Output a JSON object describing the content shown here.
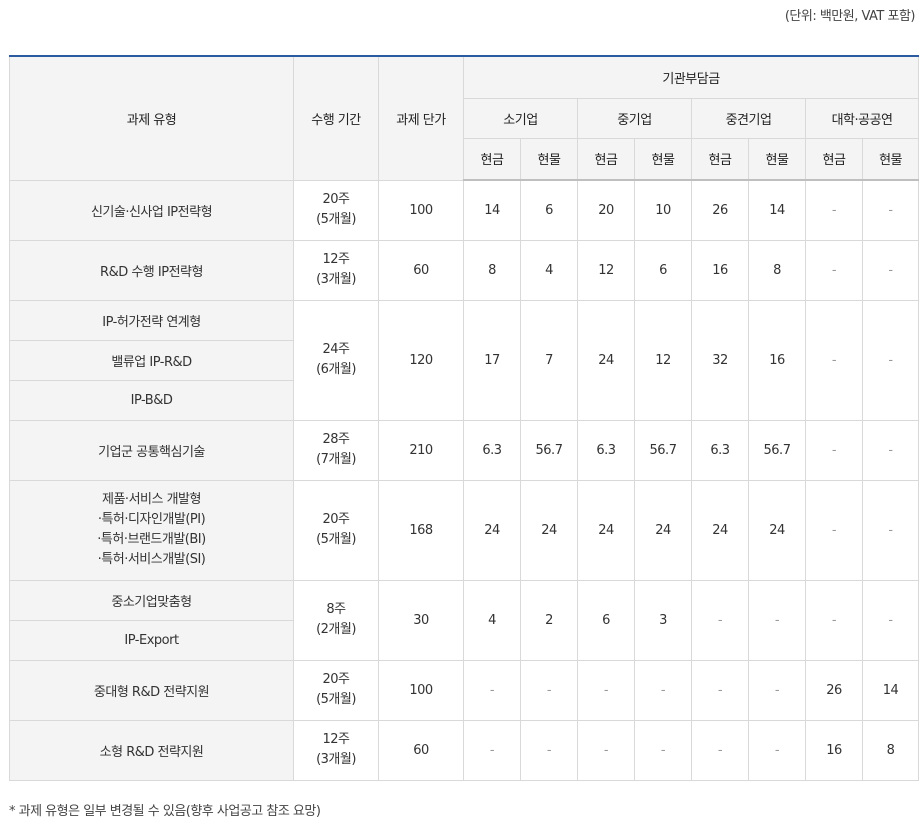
{
  "unit_note": "(단위: 백만원, VAT 포함)",
  "footnote": "* 과제 유형은 일부 변경될 수 있음(향후 사업공고 참조 요망)",
  "headers": {
    "type": "과제 유형",
    "period": "수행 기간",
    "price": "과제 단가",
    "burden": "기관부담금",
    "groups": [
      "소기업",
      "중기업",
      "중견기업",
      "대학·공공연"
    ],
    "sub": [
      "현금",
      "현물",
      "현금",
      "현물",
      "현금",
      "현물",
      "현금",
      "현물"
    ]
  },
  "rows": [
    {
      "types": [
        "신기술·신사업 IP전략형"
      ],
      "period": [
        "20주",
        "(5개월)"
      ],
      "price": "100",
      "values": [
        "14",
        "6",
        "20",
        "10",
        "26",
        "14",
        "-",
        "-"
      ]
    },
    {
      "types": [
        "R&D 수행 IP전략형"
      ],
      "period": [
        "12주",
        "(3개월)"
      ],
      "price": "60",
      "values": [
        "8",
        "4",
        "12",
        "6",
        "16",
        "8",
        "-",
        "-"
      ]
    },
    {
      "types": [
        "IP-허가전략 연계형",
        "밸류업 IP-R&D",
        "IP-B&D"
      ],
      "period": [
        "24주",
        "(6개월)"
      ],
      "price": "120",
      "values": [
        "17",
        "7",
        "24",
        "12",
        "32",
        "16",
        "-",
        "-"
      ]
    },
    {
      "types": [
        "기업군 공통핵심기술"
      ],
      "period": [
        "28주",
        "(7개월)"
      ],
      "price": "210",
      "values": [
        "6.3",
        "56.7",
        "6.3",
        "56.7",
        "6.3",
        "56.7",
        "-",
        "-"
      ]
    },
    {
      "types_multiline": [
        "제품·서비스 개발형",
        "·특허·디자인개발(PI)",
        "·특허·브랜드개발(BI)",
        "·특허·서비스개발(SI)"
      ],
      "period": [
        "20주",
        "(5개월)"
      ],
      "price": "168",
      "values": [
        "24",
        "24",
        "24",
        "24",
        "24",
        "24",
        "-",
        "-"
      ]
    },
    {
      "types": [
        "중소기업맞춤형",
        "IP-Export"
      ],
      "period": [
        "8주",
        "(2개월)"
      ],
      "price": "30",
      "values": [
        "4",
        "2",
        "6",
        "3",
        "-",
        "-",
        "-",
        "-"
      ]
    },
    {
      "types": [
        "중대형 R&D 전략지원"
      ],
      "period": [
        "20주",
        "(5개월)"
      ],
      "price": "100",
      "values": [
        "-",
        "-",
        "-",
        "-",
        "-",
        "-",
        "26",
        "14"
      ]
    },
    {
      "types": [
        "소형 R&D 전략지원"
      ],
      "period": [
        "12주",
        "(3개월)"
      ],
      "price": "60",
      "values": [
        "-",
        "-",
        "-",
        "-",
        "-",
        "-",
        "16",
        "8"
      ]
    }
  ]
}
